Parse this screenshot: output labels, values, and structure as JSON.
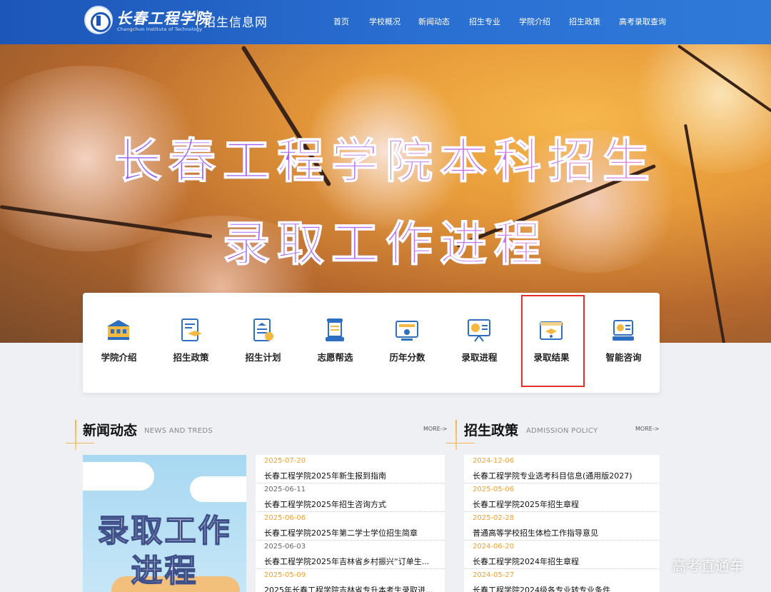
{
  "header": {
    "brand_cn": "长春工程学院",
    "brand_en": "Changchun Institute of Technology",
    "site_name": "招生信息网",
    "nav": [
      "首页",
      "学校概况",
      "新闻动态",
      "招生专业",
      "学院介绍",
      "招生政策",
      "高考录取查询"
    ]
  },
  "banner": {
    "line1": "长春工程学院本科招生",
    "line2": "录取工作进程"
  },
  "quick_links": [
    {
      "label": "学院介绍",
      "icon": "building-icon"
    },
    {
      "label": "招生政策",
      "icon": "document-icon"
    },
    {
      "label": "招生计划",
      "icon": "plan-icon"
    },
    {
      "label": "志愿帮选",
      "icon": "scroll-icon"
    },
    {
      "label": "历年分数",
      "icon": "score-board-icon"
    },
    {
      "label": "录取进程",
      "icon": "presentation-icon"
    },
    {
      "label": "录取结果",
      "icon": "graduate-folder-icon"
    },
    {
      "label": "智能咨询",
      "icon": "consult-icon"
    }
  ],
  "news": {
    "title": "新闻动态",
    "subtitle": "NEWS AND TREDS",
    "more": "MORE->",
    "promo_line1": "录取工作",
    "promo_line2": "进程",
    "items": [
      {
        "date": "2025-07-20",
        "title": "长春工程学院2025年新生报到指南"
      },
      {
        "date": "2025-06-11",
        "title": "长春工程学院2025年招生咨询方式"
      },
      {
        "date": "2025-06-06",
        "title": "长春工程学院2025年第二学士学位招生简章"
      },
      {
        "date": "2025-06-03",
        "title": "长春工程学院2025年吉林省乡村振兴“订单生..."
      },
      {
        "date": "2025-05-09",
        "title": "2025年长春工程学院吉林省专升本考生录取进..."
      }
    ]
  },
  "policy": {
    "title": "招生政策",
    "subtitle": "ADMISSION POLICY",
    "more": "MORE->",
    "items": [
      {
        "date": "2024-12-06",
        "title": "长春工程学院专业选考科目信息(通用版2027)"
      },
      {
        "date": "2025-05-06",
        "title": "长春工程学院2025年招生章程"
      },
      {
        "date": "2025-02-28",
        "title": "普通高等学校招生体检工作指导意见"
      },
      {
        "date": "2024-06-20",
        "title": "长春工程学院2024年招生章程"
      },
      {
        "date": "2024-05-27",
        "title": "长春工程学院2024级各专业转专业条件"
      }
    ]
  },
  "watermark": "高考直通车",
  "colors": {
    "header_blue": "#1c56b8",
    "date_orange": "#f0a332",
    "date_gray": "#666666",
    "highlight_red": "#e0312b"
  }
}
